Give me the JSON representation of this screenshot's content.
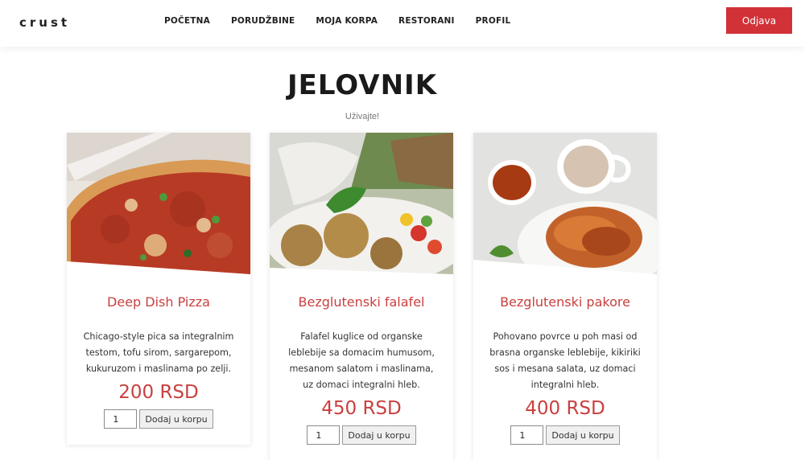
{
  "header": {
    "brand": "crust",
    "nav": [
      "POČETNA",
      "PORUDŽBINE",
      "MOJA KORPA",
      "RESTORANI",
      "PROFIL"
    ],
    "logout_label": "Odjava"
  },
  "page": {
    "title": "JELOVNIK",
    "subtitle": "Uživajte!"
  },
  "menu": [
    {
      "name": "Deep Dish Pizza",
      "description": "Chicago-style pica sa integralnim testom, tofu sirom, sargarepom, kukuruzom i maslinama po zelji.",
      "price": "200 RSD",
      "quantity": "1",
      "add_label": "Dodaj u korpu"
    },
    {
      "name": "Bezglutenski falafel",
      "description": "Falafel kuglice od organske leblebije sa domacim humusom, mesanom salatom i maslinama, uz domaci integralni hleb.",
      "price": "450 RSD",
      "quantity": "1",
      "add_label": "Dodaj u korpu"
    },
    {
      "name": "Bezglutenski pakore",
      "description": "Pohovano povrce u poh masi od brasna organske leblebije, kikiriki sos i mesana salata, uz domaci integralni hleb.",
      "price": "400 RSD",
      "quantity": "1",
      "add_label": "Dodaj u korpu"
    }
  ]
}
